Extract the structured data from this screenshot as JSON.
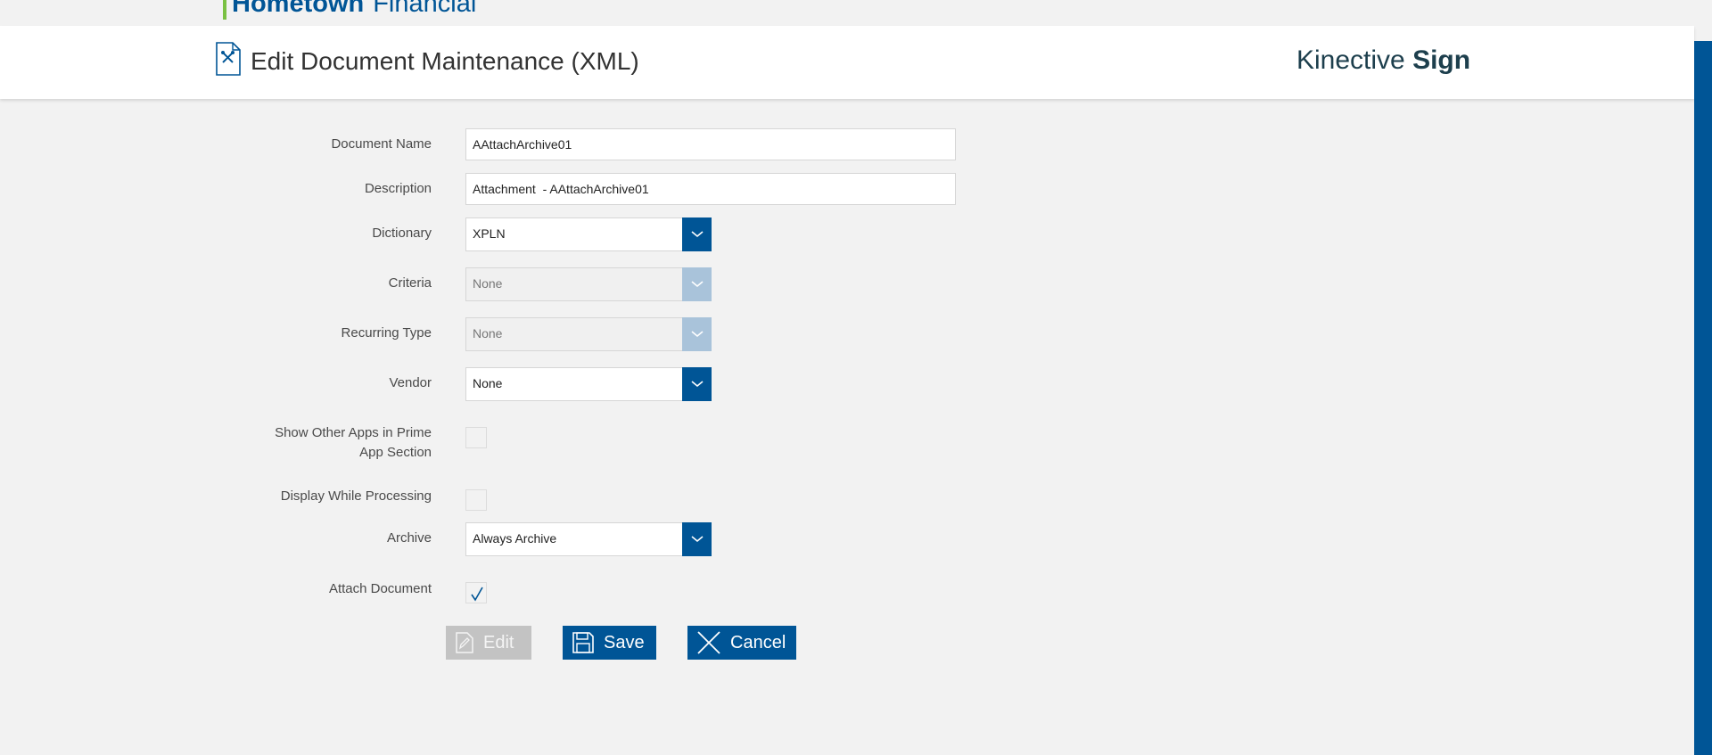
{
  "topbar": {
    "logo_word1": "Hometown",
    "logo_word2": "Financial"
  },
  "header": {
    "title": "Edit Document Maintenance (XML)",
    "brand_light": "Kinective",
    "brand_bold": "Sign"
  },
  "form": {
    "document_name": {
      "label": "Document Name",
      "value": "AAttachArchive01"
    },
    "description": {
      "label": "Description",
      "value": "Attachment  - AAttachArchive01"
    },
    "dictionary": {
      "label": "Dictionary",
      "value": "XPLN"
    },
    "criteria": {
      "label": "Criteria",
      "value": "None",
      "disabled": true
    },
    "recurring_type": {
      "label": "Recurring Type",
      "value": "None",
      "disabled": true
    },
    "vendor": {
      "label": "Vendor",
      "value": "None"
    },
    "show_other_apps": {
      "label_line1": "Show Other Apps in Prime",
      "label_line2": "App Section",
      "checked": false
    },
    "display_while_processing": {
      "label": "Display While Processing",
      "checked": false
    },
    "archive": {
      "label": "Archive",
      "value": "Always Archive"
    },
    "attach_document": {
      "label": "Attach Document",
      "checked": true
    }
  },
  "buttons": {
    "edit": "Edit",
    "save": "Save",
    "cancel": "Cancel"
  },
  "colors": {
    "primary": "#005596",
    "accent_green": "#7ac143",
    "disabled_arrow": "#a9c3da",
    "background": "#f2f2f2"
  }
}
